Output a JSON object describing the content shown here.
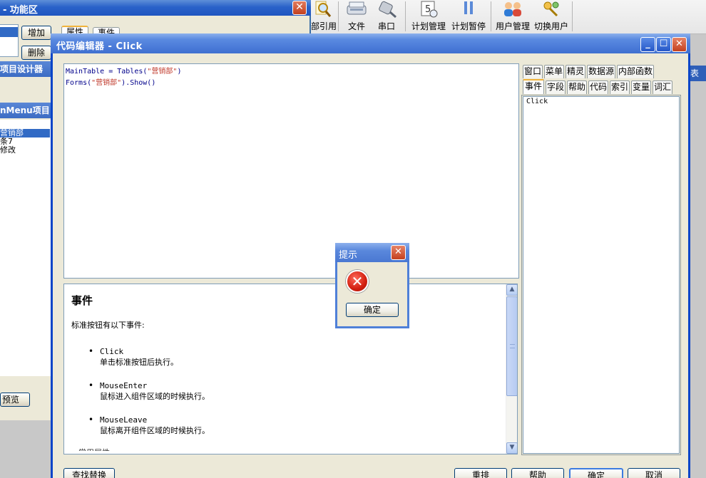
{
  "bg_window": {
    "title": "- 功能区",
    "close": "X",
    "add_button": "增加",
    "delete_button": "删除",
    "tab_props": "属性",
    "tab_events": "事件",
    "section1": "项目设计器",
    "section2": "nMenu项目",
    "tree_items": [
      "营销部",
      "条7",
      "修改"
    ],
    "preview_button": "预览"
  },
  "toolbar": {
    "items": [
      {
        "label": "部引用",
        "icon": "magnifier-icon"
      },
      {
        "label": "文件",
        "icon": "scanner-icon"
      },
      {
        "label": "串口",
        "icon": "plug-icon"
      },
      {
        "label": "计划管理",
        "icon": "calendar-icon"
      },
      {
        "label": "计划暂停",
        "icon": "pause-icon"
      },
      {
        "label": "用户管理",
        "icon": "users-icon"
      },
      {
        "label": "切换用户",
        "icon": "keys-icon"
      }
    ],
    "right_strip": "表"
  },
  "editor": {
    "title": "代码编辑器 - Click",
    "code": {
      "line1": {
        "pre": "MainTable = Tables(",
        "str": "\"营销部\"",
        "post": ")"
      },
      "line2": {
        "pre": "Forms(",
        "str": "\"营销部\"",
        "post": ").Show()"
      }
    },
    "help": {
      "heading": "事件",
      "lead": "标准按钮有以下事件:",
      "events": [
        {
          "name": "Click",
          "desc": "单击标准按钮后执行。"
        },
        {
          "name": "MouseEnter",
          "desc": "鼠标进入组件区域的时候执行。"
        },
        {
          "name": "MouseLeave",
          "desc": "鼠标离开组件区域的时候执行。"
        }
      ],
      "cut_text": "• 常用属性"
    },
    "tabs_row1": [
      "窗口",
      "菜单",
      "精灵",
      "数据源",
      "内部函数"
    ],
    "tabs_row2": [
      "事件",
      "字段",
      "帮助",
      "代码",
      "索引",
      "变量",
      "词汇"
    ],
    "side_list": [
      "Click"
    ],
    "buttons": {
      "find_replace": "查找替换",
      "rearrange": "重排",
      "help": "帮助",
      "ok": "确定",
      "cancel": "取消"
    }
  },
  "msgbox": {
    "title": "提示",
    "close": "X",
    "icon": "error-icon",
    "ok": "确定"
  },
  "colors": {
    "title_blue": "#3f70d0",
    "error_red": "#d21f10",
    "string_red": "#c0392b",
    "code_blue": "#00008b"
  }
}
